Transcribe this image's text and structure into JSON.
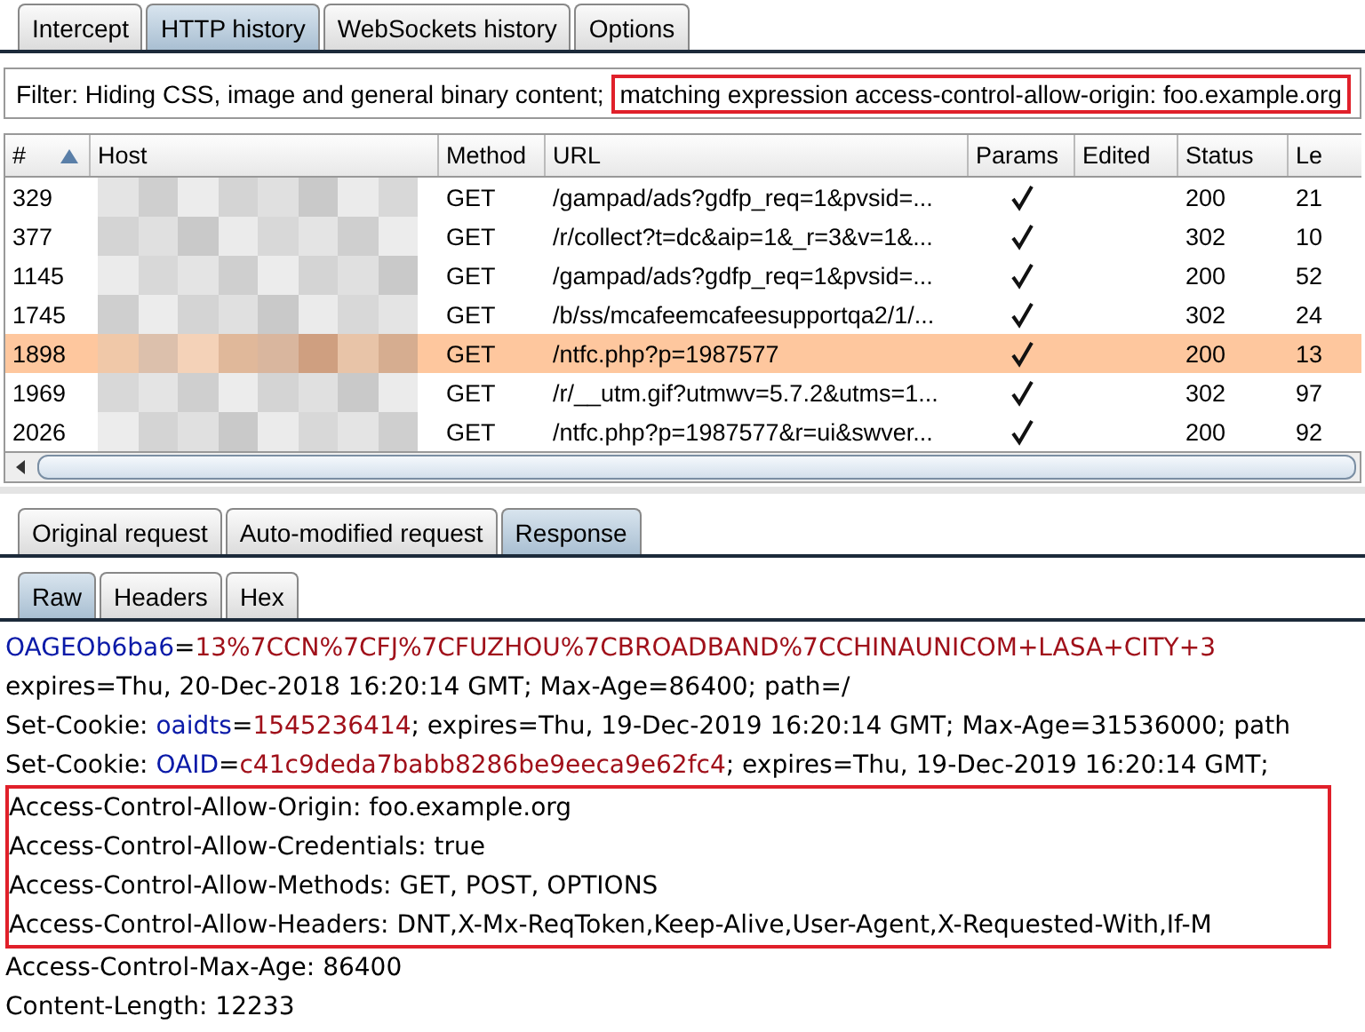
{
  "tabs": [
    {
      "label": "Intercept",
      "selected": false
    },
    {
      "label": "HTTP history",
      "selected": true
    },
    {
      "label": "WebSockets history",
      "selected": false
    },
    {
      "label": "Options",
      "selected": false
    }
  ],
  "filter": {
    "prefix": "Filter: Hiding CSS, image and general binary content;",
    "expression": "matching expression access-control-allow-origin: foo.example.org",
    "expression_boxed": true
  },
  "table": {
    "columns": [
      {
        "label": "#",
        "sorted": true
      },
      {
        "label": "Host",
        "sorted": false
      },
      {
        "label": "Method",
        "sorted": false
      },
      {
        "label": "URL",
        "sorted": false
      },
      {
        "label": "Params",
        "sorted": false
      },
      {
        "label": "Edited",
        "sorted": false
      },
      {
        "label": "Status",
        "sorted": false
      },
      {
        "label": "Le",
        "sorted": false
      }
    ],
    "rows": [
      {
        "id": "329",
        "method": "GET",
        "url": "/gampad/ads?gdfp_req=1&pvsid=...",
        "params": true,
        "status": "200",
        "length": "21",
        "selected": false
      },
      {
        "id": "377",
        "method": "GET",
        "url": "/r/collect?t=dc&aip=1&_r=3&v=1&...",
        "params": true,
        "status": "302",
        "length": "10",
        "selected": false
      },
      {
        "id": "1145",
        "method": "GET",
        "url": "/gampad/ads?gdfp_req=1&pvsid=...",
        "params": true,
        "status": "200",
        "length": "52",
        "selected": false
      },
      {
        "id": "1745",
        "method": "GET",
        "url": "/b/ss/mcafeemcafeesupportqa2/1/...",
        "params": true,
        "status": "302",
        "length": "24",
        "selected": false
      },
      {
        "id": "1898",
        "method": "GET",
        "url": "/ntfc.php?p=1987577",
        "params": true,
        "status": "200",
        "length": "13",
        "selected": true
      },
      {
        "id": "1969",
        "method": "GET",
        "url": "/r/__utm.gif?utmwv=5.7.2&utms=1...",
        "params": true,
        "status": "302",
        "length": "97",
        "selected": false
      },
      {
        "id": "2026",
        "method": "GET",
        "url": "/ntfc.php?p=1987577&r=ui&swver...",
        "params": true,
        "status": "200",
        "length": "92",
        "selected": false
      }
    ]
  },
  "message_tabs": [
    {
      "label": "Original request",
      "selected": false
    },
    {
      "label": "Auto-modified request",
      "selected": false
    },
    {
      "label": "Response",
      "selected": true
    }
  ],
  "view_tabs": [
    {
      "label": "Raw",
      "selected": true
    },
    {
      "label": "Headers",
      "selected": false
    },
    {
      "label": "Hex",
      "selected": false
    }
  ],
  "response": {
    "sections": [
      {
        "boxed": false,
        "lines": [
          [
            {
              "kind": "name",
              "text": "OAGEOb6ba6"
            },
            {
              "kind": "plain",
              "text": "="
            },
            {
              "kind": "value",
              "text": "13%7CCN%7CFJ%7CFUZHOU%7CBROADBAND%7CCHINAUNICOM+LASA+CITY+3"
            }
          ],
          [
            {
              "kind": "plain",
              "text": "expires=Thu, 20-Dec-2018 16:20:14 GMT; Max-Age=86400; path=/"
            }
          ],
          [
            {
              "kind": "plain",
              "text": "Set-Cookie: "
            },
            {
              "kind": "name",
              "text": "oaidts"
            },
            {
              "kind": "plain",
              "text": "="
            },
            {
              "kind": "value",
              "text": "1545236414"
            },
            {
              "kind": "plain",
              "text": "; expires=Thu, 19-Dec-2019 16:20:14 GMT; Max-Age=31536000; path"
            }
          ],
          [
            {
              "kind": "plain",
              "text": "Set-Cookie: "
            },
            {
              "kind": "name",
              "text": "OAID"
            },
            {
              "kind": "plain",
              "text": "="
            },
            {
              "kind": "value",
              "text": "c41c9deda7babb8286be9eeca9e62fc4"
            },
            {
              "kind": "plain",
              "text": "; expires=Thu, 19-Dec-2019 16:20:14 GMT;"
            }
          ]
        ]
      },
      {
        "boxed": true,
        "lines": [
          [
            {
              "kind": "plain",
              "text": "Access-Control-Allow-Origin: foo.example.org"
            }
          ],
          [
            {
              "kind": "plain",
              "text": "Access-Control-Allow-Credentials: true"
            }
          ],
          [
            {
              "kind": "plain",
              "text": "Access-Control-Allow-Methods: GET, POST, OPTIONS"
            }
          ],
          [
            {
              "kind": "plain",
              "text": "Access-Control-Allow-Headers: DNT,X-Mx-ReqToken,Keep-Alive,User-Agent,X-Requested-With,If-M"
            }
          ]
        ]
      },
      {
        "boxed": false,
        "lines": [
          [
            {
              "kind": "plain",
              "text": "Access-Control-Max-Age: 86400"
            }
          ],
          [
            {
              "kind": "plain",
              "text": "Content-Length: 12233"
            }
          ]
        ]
      }
    ]
  }
}
